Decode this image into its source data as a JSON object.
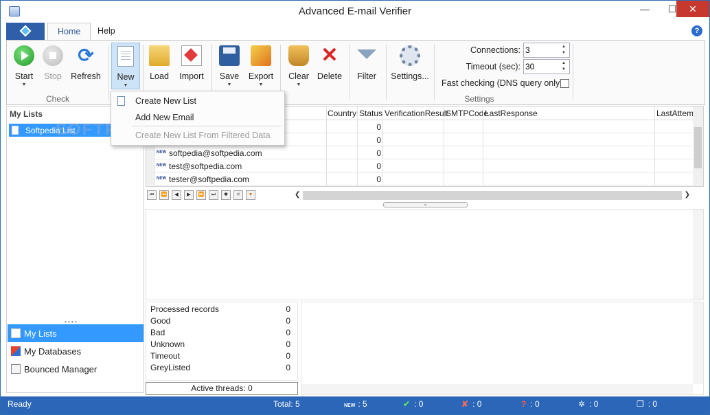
{
  "window": {
    "title": "Advanced E-mail Verifier"
  },
  "tabs": [
    {
      "label": "Home"
    },
    {
      "label": "Help"
    }
  ],
  "ribbon": {
    "check_group": {
      "label": "Check",
      "start": "Start",
      "stop": "Stop",
      "refresh": "Refresh"
    },
    "list_group": {
      "new": "New",
      "load": "Load",
      "import": "Import",
      "save": "Save",
      "export": "Export",
      "clear": "Clear",
      "delete": "Delete",
      "filter": "Filter"
    },
    "settings_group": {
      "label": "Settings",
      "settings_button": "Settings...",
      "connections_label": "Connections:",
      "connections_value": "3",
      "timeout_label": "Timeout (sec):",
      "timeout_value": "30",
      "fast_checking_label": "Fast checking (DNS query only)",
      "fast_checking_checked": false
    }
  },
  "new_menu": {
    "items": [
      {
        "label": "Create New List",
        "enabled": true
      },
      {
        "label": "Add New Email",
        "enabled": true
      },
      {
        "label": "Create New List From Filtered Data",
        "enabled": false
      }
    ]
  },
  "left_panel": {
    "header": "My Lists",
    "lists": [
      {
        "label": "Softpedia List"
      }
    ],
    "nav": [
      {
        "label": "My Lists"
      },
      {
        "label": "My Databases"
      },
      {
        "label": "Bounced Manager"
      }
    ]
  },
  "watermark": "SOFTPEDIA",
  "grid": {
    "columns": [
      "Country",
      "Status",
      "VerificationResult",
      "SMTPCode",
      "LastResponse",
      "LastAttemp"
    ],
    "rows": [
      {
        "badge": "",
        "email": "",
        "status": "0"
      },
      {
        "badge": "",
        "email": "",
        "status": "0"
      },
      {
        "badge": "NEW",
        "email": "softpedia@softpedia.com",
        "status": "0"
      },
      {
        "badge": "NEW",
        "email": "test@softpedia.com",
        "status": "0"
      },
      {
        "badge": "NEW",
        "email": "tester@softpedia.com",
        "status": "0"
      }
    ]
  },
  "stats": [
    {
      "label": "Processed records",
      "value": "0"
    },
    {
      "label": "Good",
      "value": "0"
    },
    {
      "label": "Bad",
      "value": "0"
    },
    {
      "label": "Unknown",
      "value": "0"
    },
    {
      "label": "Timeout",
      "value": "0"
    },
    {
      "label": "GreyListed",
      "value": "0"
    }
  ],
  "active_threads": "Active threads: 0",
  "statusbar": {
    "state": "Ready",
    "total": "Total: 5",
    "new_badge": "NEW",
    "new_count": ": 5",
    "good_count": ": 0",
    "bad_count": ": 0",
    "unknown_count": ": 0",
    "timeout_count": ": 0",
    "greylisted_count": ": 0"
  },
  "colors": {
    "accent": "#2b66b8",
    "selection": "#3399ff",
    "close_button": "#c7392f"
  }
}
